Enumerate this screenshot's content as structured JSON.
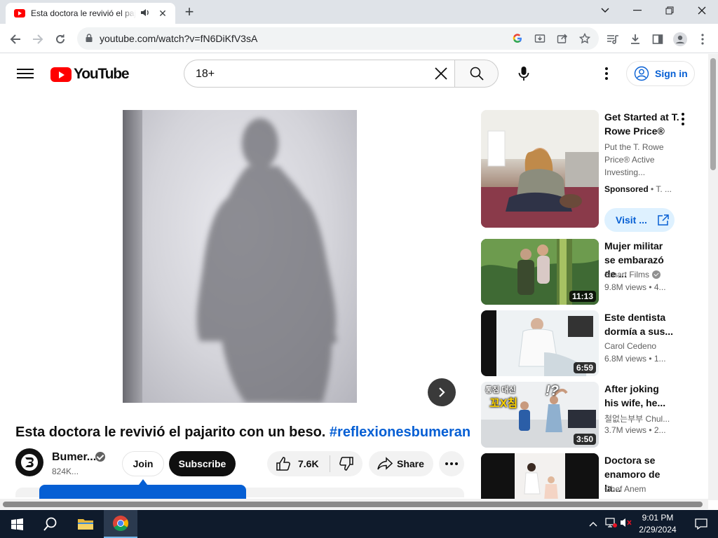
{
  "browser": {
    "tab_title": "Esta doctora le revivió el pajarito con un beso.",
    "url": "youtube.com/watch?v=fN6DiKfV3sA",
    "icons": [
      "new-tab-icon",
      "back-icon",
      "forward-icon",
      "reload-icon",
      "lock-icon",
      "google-icon",
      "install-icon",
      "share-icon",
      "bookmark-star-icon",
      "reading-list-icon",
      "downloads-icon",
      "side-panel-icon",
      "profile-icon",
      "menu-icon"
    ]
  },
  "youtube": {
    "logo_text": "YouTube",
    "search_query": "18+",
    "signin_label": "Sign in"
  },
  "video": {
    "title_main": "Esta doctora le revivió el pajarito con un beso. ",
    "title_hashtag": "#reflexionesbumeran",
    "channel_name": "Bumer...",
    "channel_subs": "824K...",
    "join_label": "Join",
    "subscribe_label": "Subscribe",
    "likes": "7.6K",
    "share_label": "Share"
  },
  "recommendations": {
    "ad": {
      "title": "Get Started at T. Rowe Price®",
      "description": "Put the T. Rowe Price® Active Investing...",
      "sponsored": "Sponsored",
      "advertiser": " • T. ...",
      "visit_label": "Visit ..."
    },
    "items": [
      {
        "title": "Mujer militar se embarazó de ...",
        "channel": "Smart Films",
        "verified": true,
        "meta": "9.8M views  • 4...",
        "duration": "11:13"
      },
      {
        "title": "Este dentista dormía a sus...",
        "channel": "Carol Cedeno",
        "verified": false,
        "meta": "6.8M views  • 1...",
        "duration": "6:59"
      },
      {
        "title": "After joking his wife, he...",
        "channel": "철없는부부 Chul...",
        "verified": false,
        "meta": "3.7M views  • 2...",
        "duration": "3:50",
        "thumb_text_1": "통침 대신",
        "thumb_text_2": "꼬X침",
        "thumb_text_3": "!?"
      },
      {
        "title": "Doctora se enamoro de la...",
        "channel": "Chef Anem",
        "verified": false,
        "meta": "",
        "duration": ""
      }
    ]
  },
  "taskbar": {
    "time": "9:01 PM",
    "date": "2/29/2024"
  },
  "colors": {
    "youtube_red": "#ff0000",
    "link_blue": "#065fd4",
    "taskbar": "#0f1b2c"
  }
}
